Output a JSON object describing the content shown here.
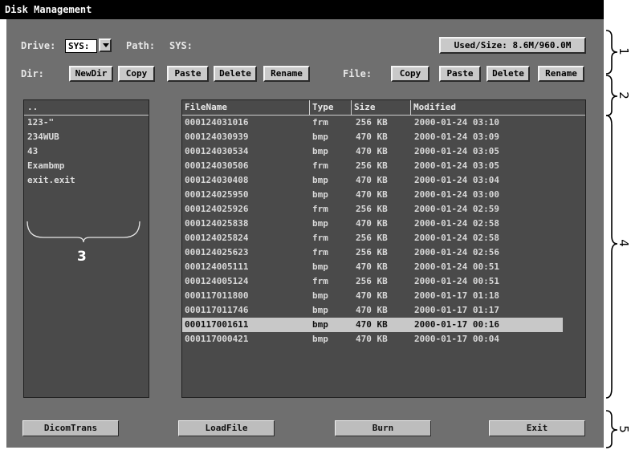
{
  "window": {
    "title": "Disk Management"
  },
  "drive": {
    "label": "Drive:",
    "value": "SYS:",
    "path_label": "Path:",
    "path_value": "SYS:",
    "used_size": "Used/Size: 8.6M/960.0M"
  },
  "dir_toolbar": {
    "label": "Dir:",
    "newdir": "NewDir",
    "copy": "Copy",
    "paste": "Paste",
    "delete": "Delete",
    "rename": "Rename"
  },
  "file_toolbar": {
    "label": "File:",
    "copy": "Copy",
    "paste": "Paste",
    "delete": "Delete",
    "rename": "Rename"
  },
  "dir_list": {
    "header": "..",
    "items": [
      "123-\"",
      "234WUB",
      "43",
      "Exambmp",
      "exit.exit"
    ]
  },
  "file_table": {
    "columns": [
      "FileName",
      "Type",
      "Size",
      "Modified"
    ],
    "rows": [
      [
        "000124031016",
        "frm",
        "256 KB",
        "2000-01-24 03:10"
      ],
      [
        "000124030939",
        "bmp",
        "470 KB",
        "2000-01-24 03:09"
      ],
      [
        "000124030534",
        "bmp",
        "470 KB",
        "2000-01-24 03:05"
      ],
      [
        "000124030506",
        "frm",
        "256 KB",
        "2000-01-24 03:05"
      ],
      [
        "000124030408",
        "bmp",
        "470 KB",
        "2000-01-24 03:04"
      ],
      [
        "000124025950",
        "bmp",
        "470 KB",
        "2000-01-24 03:00"
      ],
      [
        "000124025926",
        "frm",
        "256 KB",
        "2000-01-24 02:59"
      ],
      [
        "000124025838",
        "bmp",
        "470 KB",
        "2000-01-24 02:58"
      ],
      [
        "000124025824",
        "frm",
        "256 KB",
        "2000-01-24 02:58"
      ],
      [
        "000124025623",
        "frm",
        "256 KB",
        "2000-01-24 02:56"
      ],
      [
        "000124005111",
        "bmp",
        "470 KB",
        "2000-01-24 00:51"
      ],
      [
        "000124005124",
        "frm",
        "256 KB",
        "2000-01-24 00:51"
      ],
      [
        "000117011800",
        "bmp",
        "470 KB",
        "2000-01-17 01:18"
      ],
      [
        "000117011746",
        "bmp",
        "470 KB",
        "2000-01-17 01:17"
      ],
      [
        "000117001611",
        "bmp",
        "470 KB",
        "2000-01-17 00:16"
      ],
      [
        "000117000421",
        "bmp",
        "470 KB",
        "2000-01-17 00:04"
      ]
    ],
    "selected_row": 14
  },
  "bottom": {
    "dicomtrans": "DicomTrans",
    "loadfile": "LoadFile",
    "burn": "Burn",
    "exit": "Exit"
  },
  "annotations": {
    "n1": "1",
    "n2": "2",
    "n3": "3",
    "n4": "4",
    "n5": "5"
  }
}
